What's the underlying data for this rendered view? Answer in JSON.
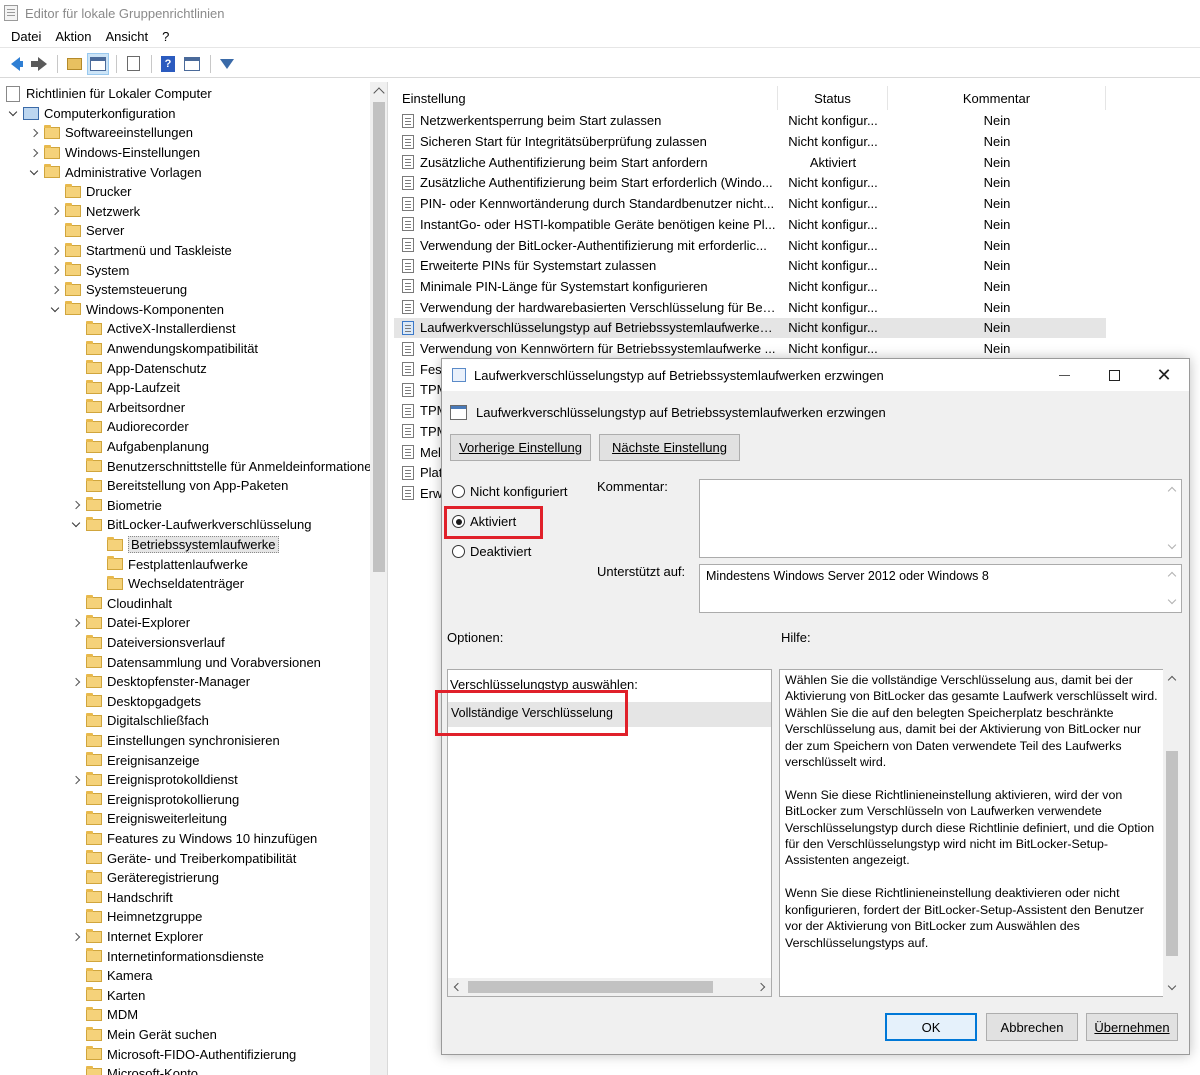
{
  "window": {
    "title": "Editor für lokale Gruppenrichtlinien"
  },
  "menu": [
    "Datei",
    "Aktion",
    "Ansicht",
    "?"
  ],
  "toolbar": {
    "icons": [
      "back-arrow-icon",
      "forward-arrow-icon",
      "folder-up-icon",
      "show-hide-tree-icon",
      "export-list-icon",
      "help-icon",
      "properties-icon",
      "filter-icon"
    ],
    "help_glyph": "?"
  },
  "tree": {
    "items": [
      {
        "label": "Richtlinien für Lokaler Computer",
        "level": 0,
        "toggle": "none",
        "icon": "doc"
      },
      {
        "label": "Computerkonfiguration",
        "level": 0,
        "toggle": "open",
        "icon": "pc"
      },
      {
        "label": "Softwareeinstellungen",
        "level": 1,
        "toggle": "closed",
        "icon": "folder"
      },
      {
        "label": "Windows-Einstellungen",
        "level": 1,
        "toggle": "closed",
        "icon": "folder"
      },
      {
        "label": "Administrative Vorlagen",
        "level": 1,
        "toggle": "open",
        "icon": "folder"
      },
      {
        "label": "Drucker",
        "level": 2,
        "toggle": "none",
        "icon": "folder"
      },
      {
        "label": "Netzwerk",
        "level": 2,
        "toggle": "closed",
        "icon": "folder"
      },
      {
        "label": "Server",
        "level": 2,
        "toggle": "none",
        "icon": "folder"
      },
      {
        "label": "Startmenü und Taskleiste",
        "level": 2,
        "toggle": "closed",
        "icon": "folder"
      },
      {
        "label": "System",
        "level": 2,
        "toggle": "closed",
        "icon": "folder"
      },
      {
        "label": "Systemsteuerung",
        "level": 2,
        "toggle": "closed",
        "icon": "folder"
      },
      {
        "label": "Windows-Komponenten",
        "level": 2,
        "toggle": "open",
        "icon": "folder"
      },
      {
        "label": "ActiveX-Installerdienst",
        "level": 3,
        "toggle": "none",
        "icon": "folder"
      },
      {
        "label": "Anwendungskompatibilität",
        "level": 3,
        "toggle": "none",
        "icon": "folder"
      },
      {
        "label": "App-Datenschutz",
        "level": 3,
        "toggle": "none",
        "icon": "folder"
      },
      {
        "label": "App-Laufzeit",
        "level": 3,
        "toggle": "none",
        "icon": "folder"
      },
      {
        "label": "Arbeitsordner",
        "level": 3,
        "toggle": "none",
        "icon": "folder"
      },
      {
        "label": "Audiorecorder",
        "level": 3,
        "toggle": "none",
        "icon": "folder"
      },
      {
        "label": "Aufgabenplanung",
        "level": 3,
        "toggle": "none",
        "icon": "folder"
      },
      {
        "label": "Benutzerschnittstelle für Anmeldeinformationen",
        "level": 3,
        "toggle": "none",
        "icon": "folder"
      },
      {
        "label": "Bereitstellung von App-Paketen",
        "level": 3,
        "toggle": "none",
        "icon": "folder"
      },
      {
        "label": "Biometrie",
        "level": 3,
        "toggle": "closed",
        "icon": "folder"
      },
      {
        "label": "BitLocker-Laufwerkverschlüsselung",
        "level": 3,
        "toggle": "open",
        "icon": "folder"
      },
      {
        "label": "Betriebssystemlaufwerke",
        "level": 4,
        "toggle": "none",
        "icon": "folder",
        "selected": true
      },
      {
        "label": "Festplattenlaufwerke",
        "level": 4,
        "toggle": "none",
        "icon": "folder"
      },
      {
        "label": "Wechseldatenträger",
        "level": 4,
        "toggle": "none",
        "icon": "folder"
      },
      {
        "label": "Cloudinhalt",
        "level": 3,
        "toggle": "none",
        "icon": "folder"
      },
      {
        "label": "Datei-Explorer",
        "level": 3,
        "toggle": "closed",
        "icon": "folder"
      },
      {
        "label": "Dateiversionsverlauf",
        "level": 3,
        "toggle": "none",
        "icon": "folder"
      },
      {
        "label": "Datensammlung und Vorabversionen",
        "level": 3,
        "toggle": "none",
        "icon": "folder"
      },
      {
        "label": "Desktopfenster-Manager",
        "level": 3,
        "toggle": "closed",
        "icon": "folder"
      },
      {
        "label": "Desktopgadgets",
        "level": 3,
        "toggle": "none",
        "icon": "folder"
      },
      {
        "label": "Digitalschließfach",
        "level": 3,
        "toggle": "none",
        "icon": "folder"
      },
      {
        "label": "Einstellungen synchronisieren",
        "level": 3,
        "toggle": "none",
        "icon": "folder"
      },
      {
        "label": "Ereignisanzeige",
        "level": 3,
        "toggle": "none",
        "icon": "folder"
      },
      {
        "label": "Ereignisprotokolldienst",
        "level": 3,
        "toggle": "closed",
        "icon": "folder"
      },
      {
        "label": "Ereignisprotokollierung",
        "level": 3,
        "toggle": "none",
        "icon": "folder"
      },
      {
        "label": "Ereignisweiterleitung",
        "level": 3,
        "toggle": "none",
        "icon": "folder"
      },
      {
        "label": "Features zu Windows 10 hinzufügen",
        "level": 3,
        "toggle": "none",
        "icon": "folder"
      },
      {
        "label": "Geräte- und Treiberkompatibilität",
        "level": 3,
        "toggle": "none",
        "icon": "folder"
      },
      {
        "label": "Geräteregistrierung",
        "level": 3,
        "toggle": "none",
        "icon": "folder"
      },
      {
        "label": "Handschrift",
        "level": 3,
        "toggle": "none",
        "icon": "folder"
      },
      {
        "label": "Heimnetzgruppe",
        "level": 3,
        "toggle": "none",
        "icon": "folder"
      },
      {
        "label": "Internet Explorer",
        "level": 3,
        "toggle": "closed",
        "icon": "folder"
      },
      {
        "label": "Internetinformationsdienste",
        "level": 3,
        "toggle": "none",
        "icon": "folder"
      },
      {
        "label": "Kamera",
        "level": 3,
        "toggle": "none",
        "icon": "folder"
      },
      {
        "label": "Karten",
        "level": 3,
        "toggle": "none",
        "icon": "folder"
      },
      {
        "label": "MDM",
        "level": 3,
        "toggle": "none",
        "icon": "folder"
      },
      {
        "label": "Mein Gerät suchen",
        "level": 3,
        "toggle": "none",
        "icon": "folder"
      },
      {
        "label": "Microsoft-FIDO-Authentifizierung",
        "level": 3,
        "toggle": "none",
        "icon": "folder"
      },
      {
        "label": "Microsoft-Konto",
        "level": 3,
        "toggle": "none",
        "icon": "folder"
      }
    ]
  },
  "list": {
    "columns": {
      "setting": "Einstellung",
      "status": "Status",
      "comment": "Kommentar"
    },
    "rows": [
      {
        "setting": "Netzwerkentsperrung beim Start zulassen",
        "status": "Nicht konfigur...",
        "comment": "Nein"
      },
      {
        "setting": "Sicheren Start für Integritätsüberprüfung zulassen",
        "status": "Nicht konfigur...",
        "comment": "Nein"
      },
      {
        "setting": "Zusätzliche Authentifizierung beim Start anfordern",
        "status": "Aktiviert",
        "comment": "Nein"
      },
      {
        "setting": "Zusätzliche Authentifizierung beim Start erforderlich (Windo...",
        "status": "Nicht konfigur...",
        "comment": "Nein"
      },
      {
        "setting": "PIN- oder Kennwortänderung durch Standardbenutzer nicht...",
        "status": "Nicht konfigur...",
        "comment": "Nein"
      },
      {
        "setting": "InstantGo- oder HSTI-kompatible Geräte benötigen keine Pl...",
        "status": "Nicht konfigur...",
        "comment": "Nein"
      },
      {
        "setting": "Verwendung der BitLocker-Authentifizierung mit erforderlic...",
        "status": "Nicht konfigur...",
        "comment": "Nein"
      },
      {
        "setting": "Erweiterte PINs für Systemstart zulassen",
        "status": "Nicht konfigur...",
        "comment": "Nein"
      },
      {
        "setting": "Minimale PIN-Länge für Systemstart konfigurieren",
        "status": "Nicht konfigur...",
        "comment": "Nein"
      },
      {
        "setting": "Verwendung der hardwarebasierten Verschlüsselung für Betr...",
        "status": "Nicht konfigur...",
        "comment": "Nein"
      },
      {
        "setting": "Laufwerkverschlüsselungstyp auf Betriebssystemlaufwerken ...",
        "status": "Nicht konfigur...",
        "comment": "Nein",
        "selected": true
      },
      {
        "setting": "Verwendung von Kennwörtern für Betriebssystemlaufwerke ...",
        "status": "Nicht konfigur...",
        "comment": "Nein"
      },
      {
        "setting": "Fest",
        "status": "",
        "comment": ""
      },
      {
        "setting": "TPM",
        "status": "",
        "comment": ""
      },
      {
        "setting": "TPM",
        "status": "",
        "comment": ""
      },
      {
        "setting": "TPM",
        "status": "",
        "comment": ""
      },
      {
        "setting": "Mel",
        "status": "",
        "comment": ""
      },
      {
        "setting": "Plat",
        "status": "",
        "comment": ""
      },
      {
        "setting": "Erw",
        "status": "",
        "comment": ""
      }
    ]
  },
  "dialog": {
    "title": "Laufwerkverschlüsselungstyp auf Betriebssystemlaufwerken erzwingen",
    "subtitle": "Laufwerkverschlüsselungstyp auf Betriebssystemlaufwerken erzwingen",
    "prev_button": "Vorherige Einstellung",
    "next_button": "Nächste Einstellung",
    "radio_not_configured": "Nicht konfiguriert",
    "radio_enabled": "Aktiviert",
    "radio_disabled": "Deaktiviert",
    "comment_label": "Kommentar:",
    "comment_value": "",
    "supported_label": "Unterstützt auf:",
    "supported_value": "Mindestens Windows Server 2012 oder Windows 8",
    "options_label": "Optionen:",
    "help_label": "Hilfe:",
    "option_select_label": "Verschlüsselungstyp auswählen:",
    "option_select_value": "Vollständige Verschlüsselung",
    "help_text": "Wählen Sie die vollständige Verschlüsselung aus, damit bei der Aktivierung von BitLocker das gesamte Laufwerk verschlüsselt wird. Wählen Sie die auf den belegten Speicherplatz beschränkte Verschlüsselung aus, damit bei der Aktivierung von BitLocker nur der zum Speichern von Daten verwendete Teil des Laufwerks verschlüsselt wird.\n\nWenn Sie diese Richtlinieneinstellung aktivieren, wird der von BitLocker zum Verschlüsseln von Laufwerken verwendete Verschlüsselungstyp durch diese Richtlinie definiert, und die Option für den Verschlüsselungstyp wird nicht im BitLocker-Setup-Assistenten angezeigt.\n\nWenn Sie diese Richtlinieneinstellung deaktivieren oder nicht konfigurieren, fordert der BitLocker-Setup-Assistent den Benutzer vor der Aktivierung von BitLocker zum Auswählen des Verschlüsselungstyps auf.",
    "ok_button": "OK",
    "cancel_button": "Abbrechen",
    "apply_button": "Übernehmen",
    "close_glyph": "✕",
    "enabled_selected": true,
    "highlight_color": "#e0202a"
  }
}
